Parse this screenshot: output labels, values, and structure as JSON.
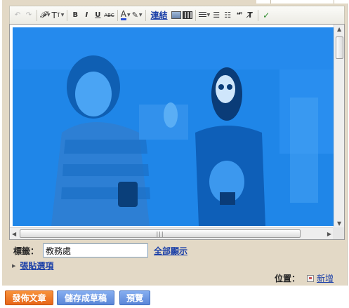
{
  "toolbar": {
    "link_label": "連結",
    "font_icon_text": "𝓕",
    "size_icon_text": "T",
    "bold": "B",
    "italic": "I",
    "underline": "U",
    "strike": "ABC",
    "text_color": "A",
    "quote": "❝❞"
  },
  "labels": {
    "caption": "標籤：",
    "value": "教務處",
    "show_all": "全部顯示"
  },
  "post_options": {
    "label": "張貼選項"
  },
  "location": {
    "label": "位置：",
    "add": "新增"
  },
  "buttons": {
    "publish": "發佈文章",
    "save_draft": "儲存成草稿",
    "preview": "預覽"
  },
  "colors": {
    "publish": "#e8661a",
    "secondary": "#5b86d8",
    "frame": "#e3d9c6",
    "link": "#1a3fa8",
    "photo_tint": "#1f86e8"
  }
}
